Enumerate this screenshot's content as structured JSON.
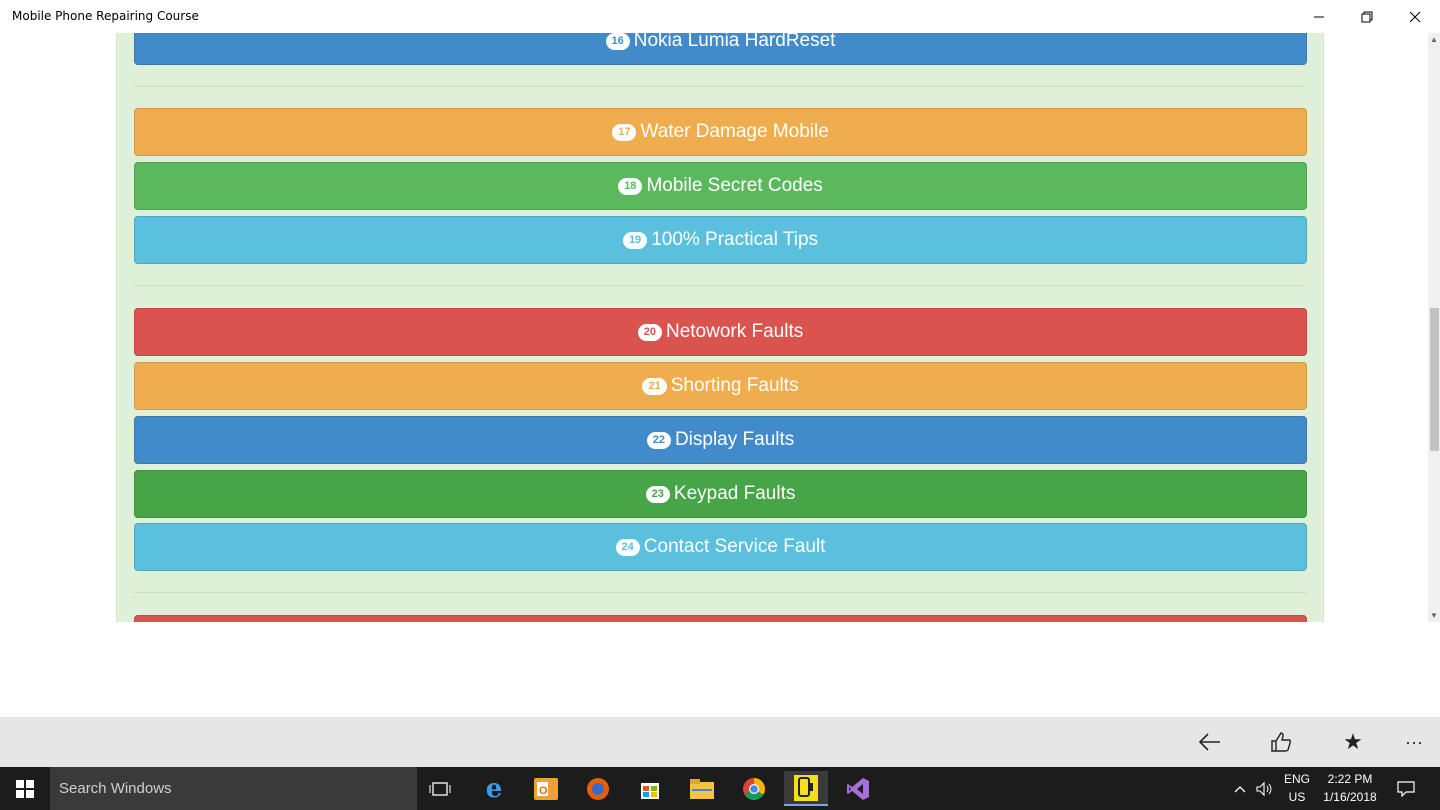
{
  "window": {
    "title": "Mobile Phone Repairing Course"
  },
  "course_items": [
    {
      "number": "16",
      "label": "Nokia Lumia HardReset",
      "color": "#428bca"
    },
    {
      "number": "17",
      "label": "Water Damage Mobile",
      "color": "#f0ad4e"
    },
    {
      "number": "18",
      "label": "Mobile Secret Codes",
      "color": "#5cb85c"
    },
    {
      "number": "19",
      "label": "100% Practical Tips",
      "color": "#5bc0de"
    },
    {
      "number": "20",
      "label": "Netowork Faults",
      "color": "#d9534f"
    },
    {
      "number": "21",
      "label": "Shorting Faults",
      "color": "#f0ad4e"
    },
    {
      "number": "22",
      "label": "Display Faults",
      "color": "#428bca"
    },
    {
      "number": "23",
      "label": "Keypad Faults",
      "color": "#47a447"
    },
    {
      "number": "24",
      "label": "Contact Service Fault",
      "color": "#5bc0de"
    },
    {
      "number": "",
      "label": "",
      "color": "#d9534f"
    }
  ],
  "appbar": {
    "icons": [
      "back-arrow-icon",
      "like-icon",
      "favorite-star-icon",
      "more-options-icon"
    ]
  },
  "taskbar": {
    "search_placeholder": "Search Windows",
    "language_top": "ENG",
    "language_bottom": "US",
    "time": "2:22 PM",
    "date": "1/16/2018"
  }
}
